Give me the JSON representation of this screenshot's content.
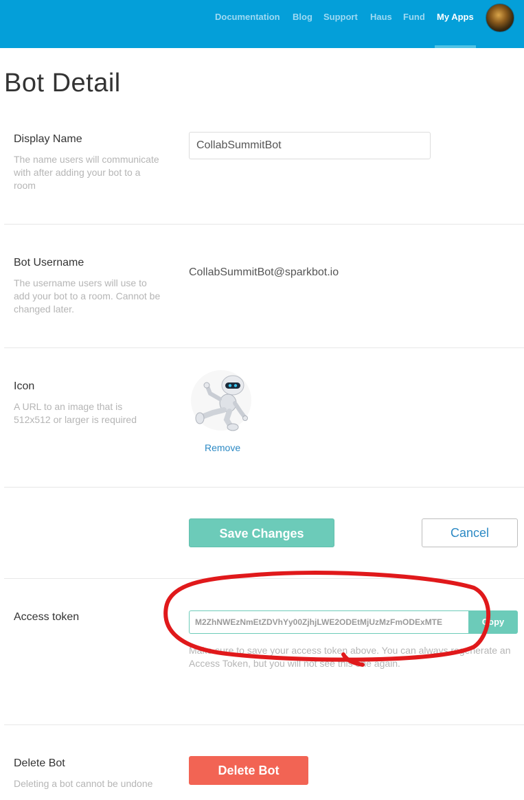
{
  "nav": {
    "items": [
      {
        "label": "Documentation",
        "active": false
      },
      {
        "label": "Blog",
        "active": false
      },
      {
        "label": "Support",
        "active": false
      },
      {
        "label": "Haus",
        "active": false
      },
      {
        "label": "Fund",
        "active": false
      },
      {
        "label": "My Apps",
        "active": true
      }
    ]
  },
  "page": {
    "title": "Bot Detail"
  },
  "display_name": {
    "label": "Display Name",
    "help": "The name users will communicate with after adding your bot to a room",
    "value": "CollabSummitBot"
  },
  "bot_username": {
    "label": "Bot Username",
    "help": "The username users will use to add your bot to a room. Cannot be changed later.",
    "value": "CollabSummitBot@sparkbot.io"
  },
  "icon": {
    "label": "Icon",
    "help": "A URL to an image that is 512x512 or larger is required",
    "remove_label": "Remove",
    "image": "robot-icon"
  },
  "actions": {
    "save_label": "Save Changes",
    "cancel_label": "Cancel"
  },
  "access_token": {
    "label": "Access token",
    "value": "M2ZhNWEzNmEtZDVhYy00ZjhjLWE2ODEtMjUzMzFmODExMTE",
    "copy_label": "Copy",
    "help": "Make sure to save your access token above. You can always regenerate an Access Token, but you will not see this one again."
  },
  "delete_bot": {
    "label": "Delete Bot",
    "help": "Deleting a bot cannot be undone",
    "button_label": "Delete Bot"
  },
  "colors": {
    "header": "#049fd9",
    "primary": "#6ccbb9",
    "danger": "#f26454",
    "link": "#2b89c4",
    "annotation": "#e0191b"
  }
}
